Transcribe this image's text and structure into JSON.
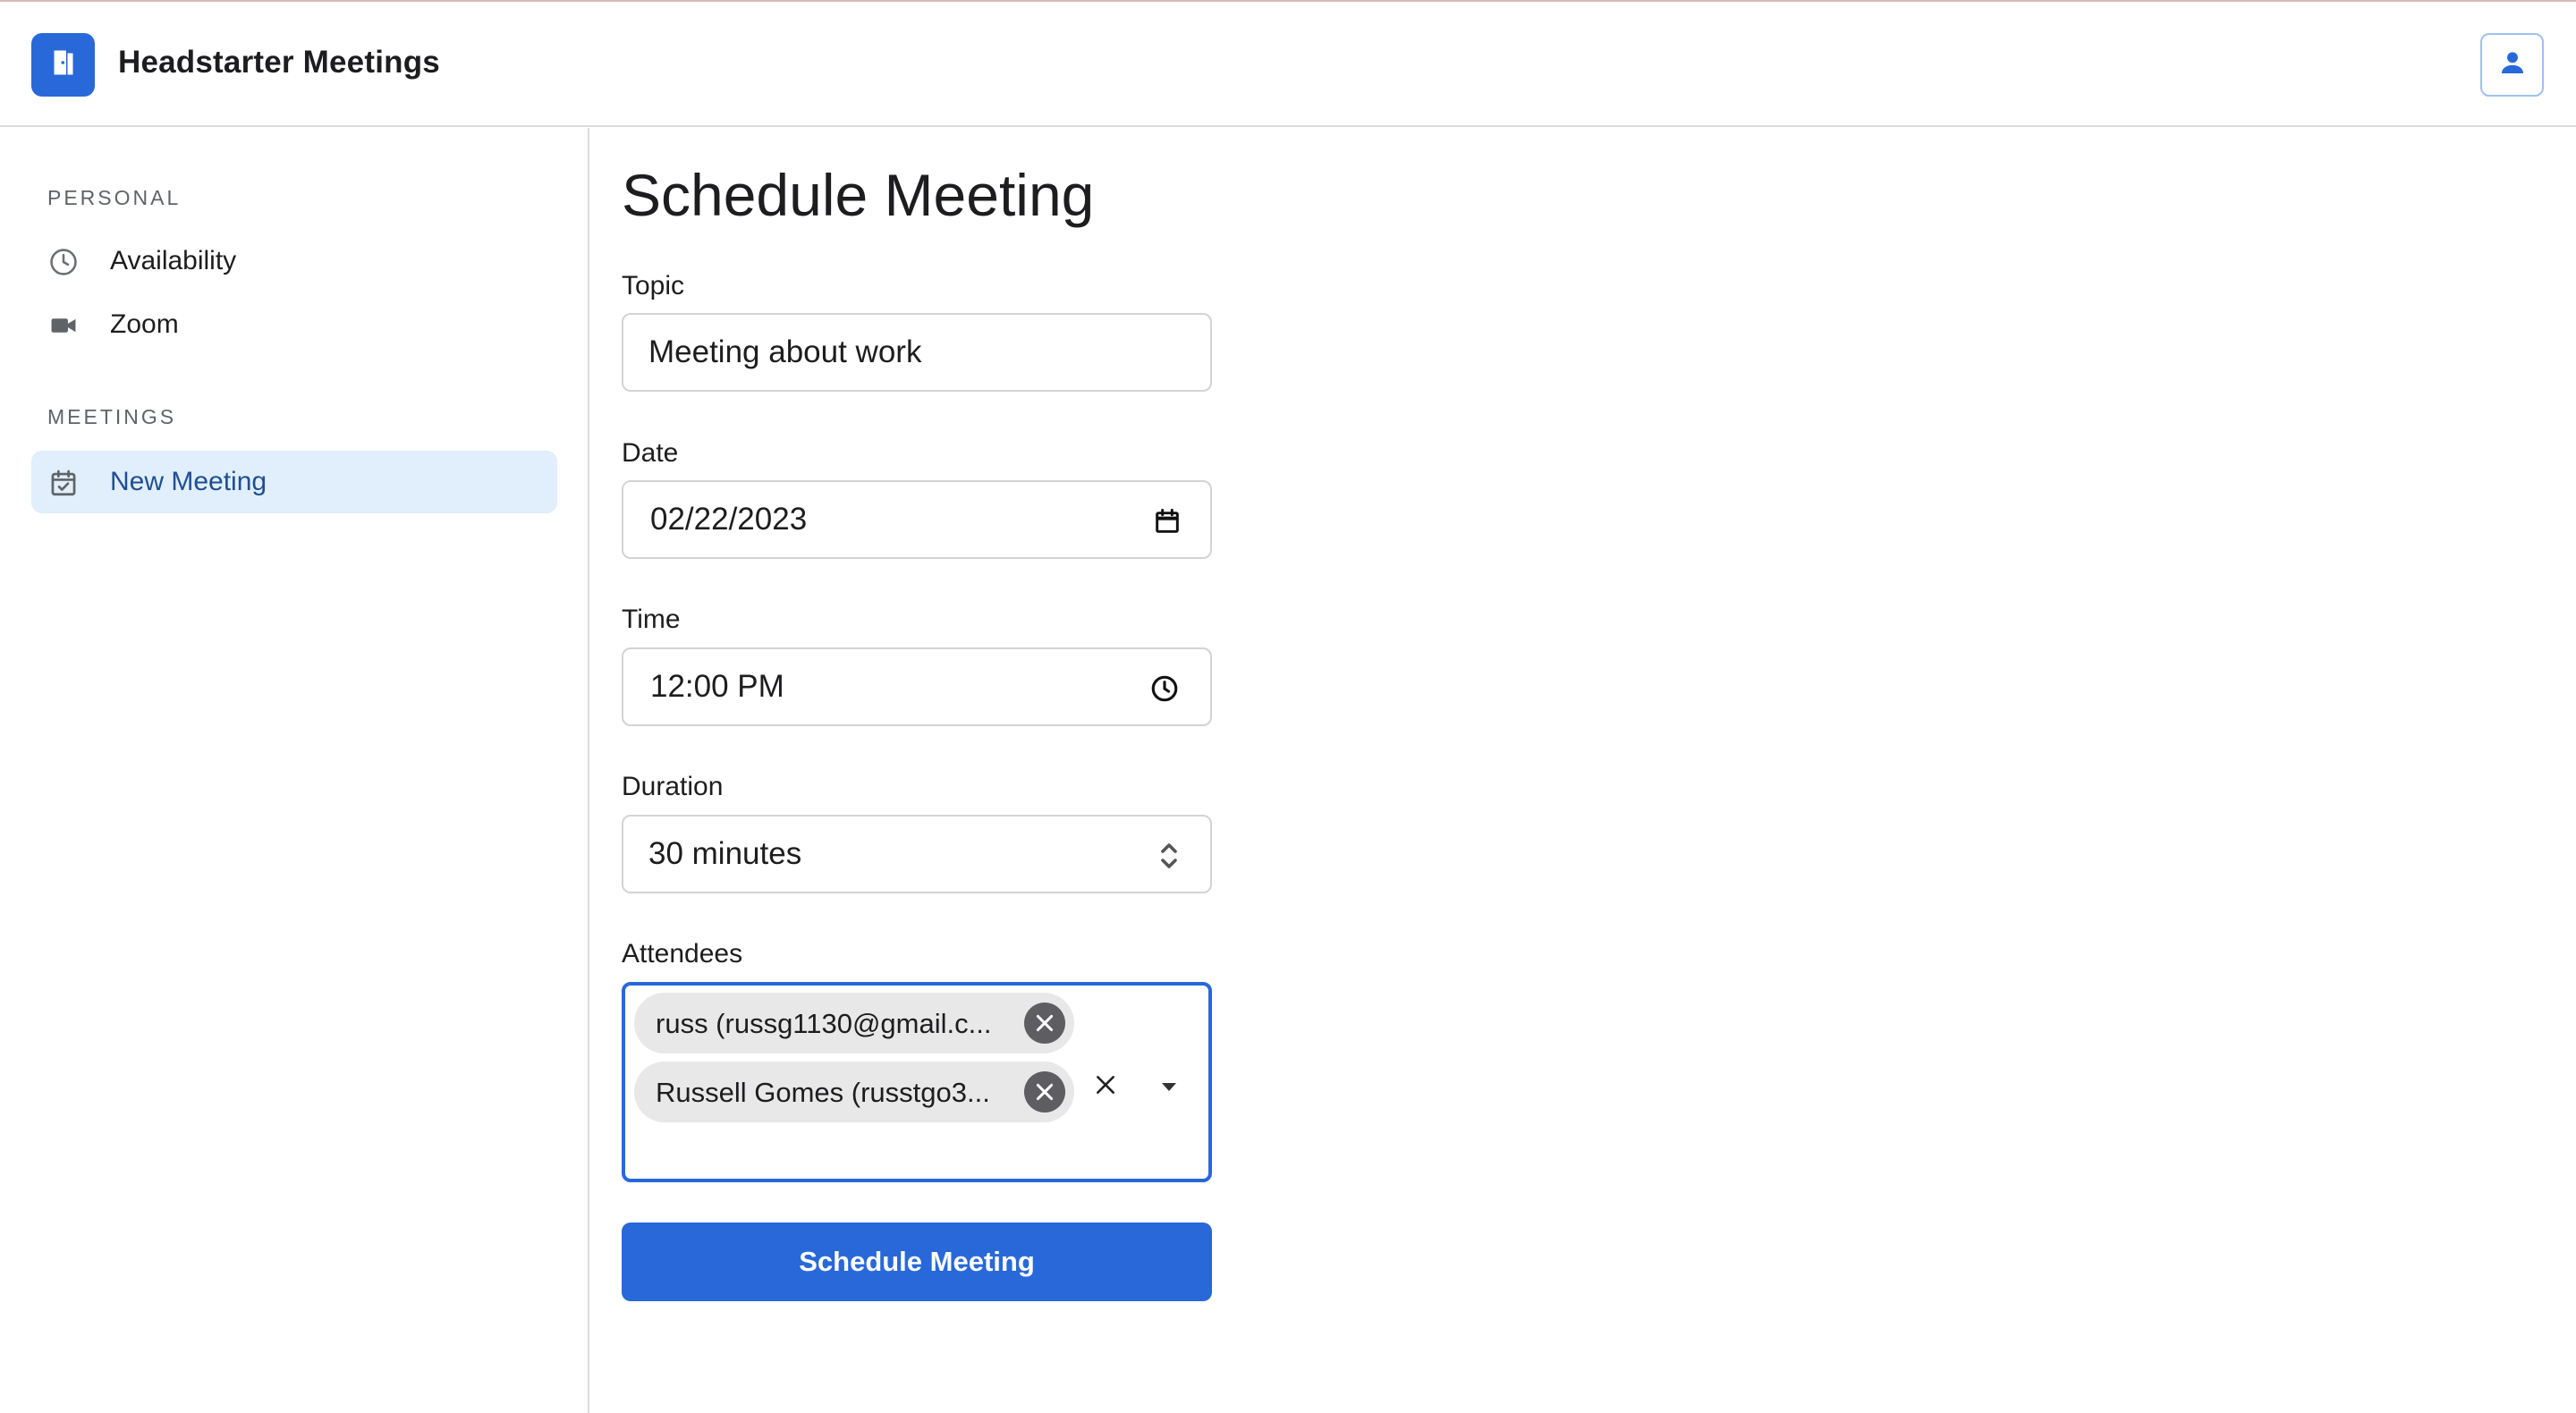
{
  "app": {
    "title": "Headstarter Meetings"
  },
  "header": {
    "user_icon": "user-icon",
    "logo_icon": "door-icon"
  },
  "sidebar": {
    "sections": [
      {
        "label": "PERSONAL",
        "items": [
          {
            "label": "Availability",
            "icon": "clock-icon",
            "active": false
          },
          {
            "label": "Zoom",
            "icon": "video-camera-icon",
            "active": false
          }
        ]
      },
      {
        "label": "MEETINGS",
        "items": [
          {
            "label": "New Meeting",
            "icon": "calendar-check-icon",
            "active": true
          }
        ]
      }
    ]
  },
  "form": {
    "title": "Schedule Meeting",
    "topic": {
      "label": "Topic",
      "value": "Meeting about work"
    },
    "date": {
      "label": "Date",
      "value": "02/22/2023",
      "icon": "calendar-icon"
    },
    "time": {
      "label": "Time",
      "value": "12:00 PM",
      "icon": "clock-icon"
    },
    "duration": {
      "label": "Duration",
      "value": "30 minutes",
      "icon": "select-arrows-icon"
    },
    "attendees": {
      "label": "Attendees",
      "chips": [
        {
          "text": "russ (russg1130@gmail.c..."
        },
        {
          "text": "Russell Gomes (russtgo3..."
        }
      ]
    },
    "submit_label": "Schedule Meeting"
  },
  "colors": {
    "accent": "#2868d9",
    "active_nav_bg": "#e1eefb",
    "active_nav_text": "#1e4f92",
    "chip_bg": "#e8e8e8"
  }
}
